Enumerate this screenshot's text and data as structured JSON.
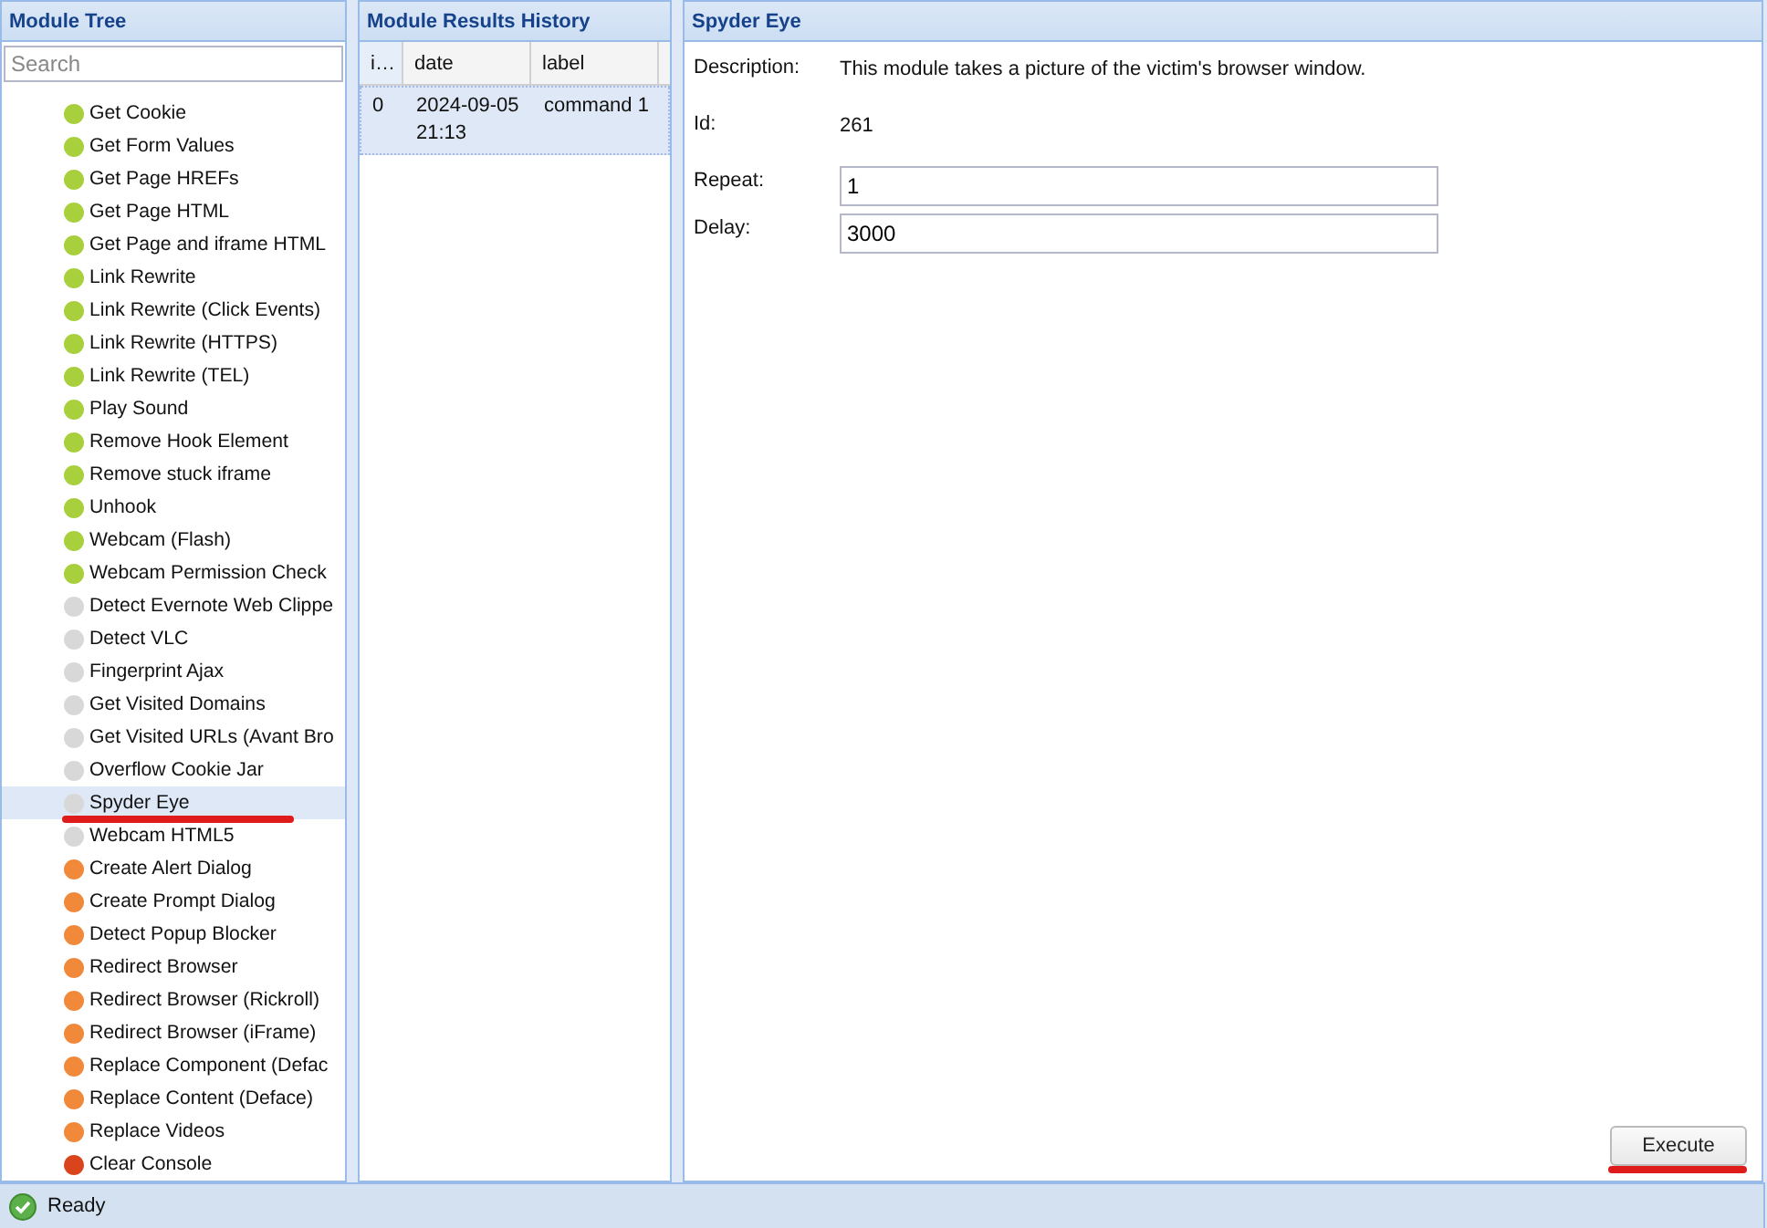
{
  "module_tree": {
    "title": "Module Tree",
    "search": {
      "placeholder": "Search"
    },
    "items": [
      {
        "label": "Get Cookie",
        "color": "#a8cf3c",
        "selected": false
      },
      {
        "label": "Get Form Values",
        "color": "#a8cf3c",
        "selected": false
      },
      {
        "label": "Get Page HREFs",
        "color": "#a8cf3c",
        "selected": false
      },
      {
        "label": "Get Page HTML",
        "color": "#a8cf3c",
        "selected": false
      },
      {
        "label": "Get Page and iframe HTML",
        "color": "#a8cf3c",
        "selected": false
      },
      {
        "label": "Link Rewrite",
        "color": "#a8cf3c",
        "selected": false
      },
      {
        "label": "Link Rewrite (Click Events)",
        "color": "#a8cf3c",
        "selected": false
      },
      {
        "label": "Link Rewrite (HTTPS)",
        "color": "#a8cf3c",
        "selected": false
      },
      {
        "label": "Link Rewrite (TEL)",
        "color": "#a8cf3c",
        "selected": false
      },
      {
        "label": "Play Sound",
        "color": "#a8cf3c",
        "selected": false
      },
      {
        "label": "Remove Hook Element",
        "color": "#a8cf3c",
        "selected": false
      },
      {
        "label": "Remove stuck iframe",
        "color": "#a8cf3c",
        "selected": false
      },
      {
        "label": "Unhook",
        "color": "#a8cf3c",
        "selected": false
      },
      {
        "label": "Webcam (Flash)",
        "color": "#a8cf3c",
        "selected": false
      },
      {
        "label": "Webcam Permission Check",
        "color": "#a8cf3c",
        "selected": false
      },
      {
        "label": "Detect Evernote Web Clippe",
        "color": "#d8d8d8",
        "selected": false
      },
      {
        "label": "Detect VLC",
        "color": "#d8d8d8",
        "selected": false
      },
      {
        "label": "Fingerprint Ajax",
        "color": "#d8d8d8",
        "selected": false
      },
      {
        "label": "Get Visited Domains",
        "color": "#d8d8d8",
        "selected": false
      },
      {
        "label": "Get Visited URLs (Avant Bro",
        "color": "#d8d8d8",
        "selected": false
      },
      {
        "label": "Overflow Cookie Jar",
        "color": "#d8d8d8",
        "selected": false
      },
      {
        "label": "Spyder Eye",
        "color": "#d8d8d8",
        "selected": true
      },
      {
        "label": "Webcam HTML5",
        "color": "#d8d8d8",
        "selected": false
      },
      {
        "label": "Create Alert Dialog",
        "color": "#f08a3a",
        "selected": false
      },
      {
        "label": "Create Prompt Dialog",
        "color": "#f08a3a",
        "selected": false
      },
      {
        "label": "Detect Popup Blocker",
        "color": "#f08a3a",
        "selected": false
      },
      {
        "label": "Redirect Browser",
        "color": "#f08a3a",
        "selected": false
      },
      {
        "label": "Redirect Browser (Rickroll)",
        "color": "#f08a3a",
        "selected": false
      },
      {
        "label": "Redirect Browser (iFrame)",
        "color": "#f08a3a",
        "selected": false
      },
      {
        "label": "Replace Component (Defac",
        "color": "#f08a3a",
        "selected": false
      },
      {
        "label": "Replace Content (Deface)",
        "color": "#f08a3a",
        "selected": false
      },
      {
        "label": "Replace Videos",
        "color": "#f08a3a",
        "selected": false
      },
      {
        "label": "Clear Console",
        "color": "#d9441c",
        "selected": false
      }
    ]
  },
  "results_history": {
    "title": "Module Results History",
    "columns": [
      "i…",
      "date",
      "label"
    ],
    "rows": [
      {
        "cells": [
          "0",
          "2024-09-05 21:13",
          "command 1"
        ],
        "selected": true
      }
    ]
  },
  "details": {
    "title": "Spyder Eye",
    "fields": [
      {
        "kind": "text",
        "label": "Description:",
        "value": "This module takes a picture of the victim's browser window."
      },
      {
        "kind": "text",
        "label": "Id:",
        "value": "261"
      },
      {
        "kind": "input",
        "label": "Repeat:",
        "value": "1"
      },
      {
        "kind": "input",
        "label": "Delay:",
        "value": "3000"
      }
    ],
    "button": "Execute"
  },
  "status_bar": {
    "text": "Ready"
  }
}
